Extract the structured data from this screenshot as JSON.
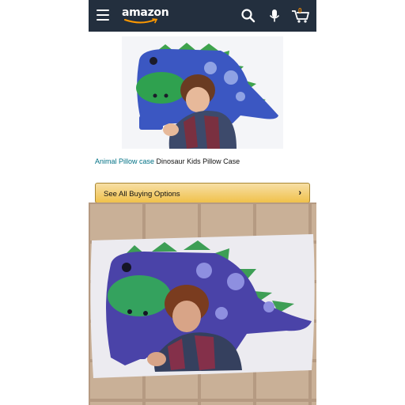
{
  "header": {
    "logo_text": "amazon",
    "background": "#232f3e",
    "cart_count": "0",
    "icons": [
      "menu-icon",
      "search-icon",
      "microphone-icon",
      "cart-icon"
    ]
  },
  "product": {
    "category_link": "Animal Pillow case",
    "title": "Dinosaur Kids Pillow Case"
  },
  "buy_button": {
    "label": "See All Buying Options",
    "chevron": "›",
    "color": "#f0c14b"
  },
  "images": [
    "hero-product-image",
    "user-photo-image"
  ]
}
